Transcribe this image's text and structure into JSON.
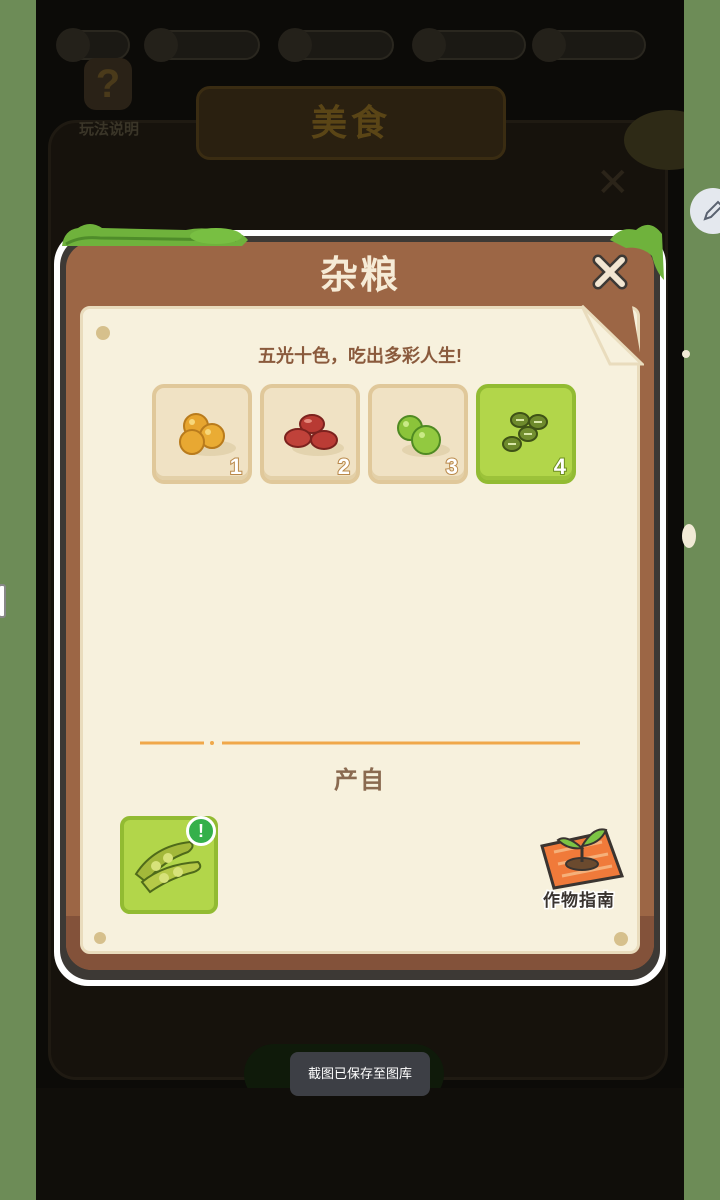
{
  "background": {
    "help_label": "玩法说明",
    "banner_title": "美食"
  },
  "dialog": {
    "title": "杂粮",
    "slogan": "五光十色，吃出多彩人生!",
    "items": [
      {
        "name": "soybeans",
        "number": "1",
        "selected": false
      },
      {
        "name": "red-beans",
        "number": "2",
        "selected": false
      },
      {
        "name": "green-peas",
        "number": "3",
        "selected": false
      },
      {
        "name": "mung-beans",
        "number": "4",
        "selected": true
      }
    ],
    "produced_from_label": "产自",
    "source_badge": "!",
    "guide_label": "作物指南"
  },
  "toast": {
    "message": "截图已保存至图库"
  },
  "colors": {
    "wood": "#9c6645",
    "paper": "#f7f1dd",
    "selected_green": "#b2d64a",
    "badge_green": "#34b04a"
  }
}
